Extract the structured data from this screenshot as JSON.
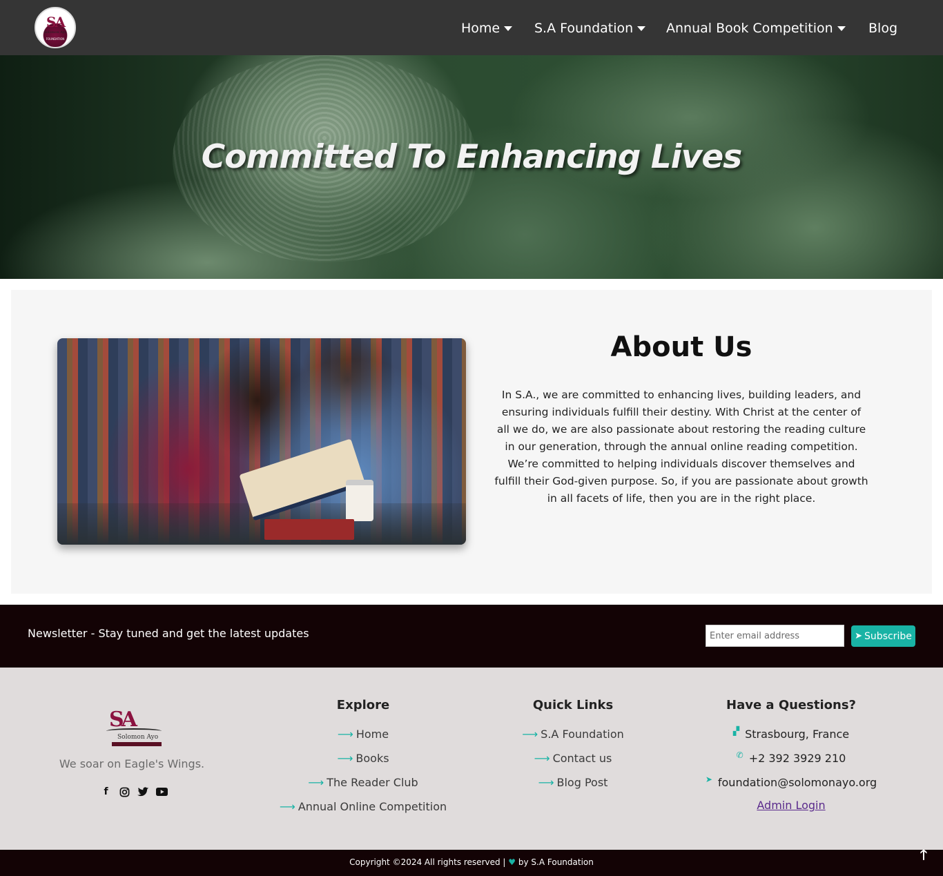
{
  "nav": {
    "items": [
      {
        "label": "Home",
        "dropdown": true
      },
      {
        "label": "S.A Foundation",
        "dropdown": true
      },
      {
        "label": "Annual Book Competition",
        "dropdown": true
      },
      {
        "label": "Blog",
        "dropdown": false
      }
    ],
    "logo_icon": "sa-foundation-logo"
  },
  "hero": {
    "title": "Committed To Enhancing Lives"
  },
  "about": {
    "title": "About Us",
    "text": "In S.A., we are committed to enhancing lives, building leaders, and ensuring individuals fulfill their destiny. With Christ at the center of all we do, we are also passionate about restoring the reading culture in our generation, through the annual online reading competition. We’re committed to helping individuals discover themselves and fulfill their God-given purpose. So, if you are passionate about growth in all facets of life, then you are in the right place."
  },
  "newsletter": {
    "text": "Newsletter - Stay tuned and get the latest updates",
    "placeholder": "Enter email address",
    "button": "Subscribe"
  },
  "footer": {
    "tagline": "We soar on Eagle's Wings.",
    "social": [
      "facebook-icon",
      "instagram-icon",
      "twitter-icon",
      "youtube-icon"
    ],
    "explore": {
      "title": "Explore",
      "links": [
        "Home",
        "Books",
        "The Reader Club",
        "Annual Online Competition"
      ]
    },
    "quick_links": {
      "title": "Quick Links",
      "links": [
        "S.A Foundation",
        "Contact us",
        "Blog Post"
      ]
    },
    "questions": {
      "title": "Have a Questions?",
      "address": "Strasbourg, France",
      "phone": "+2 392 3929 210",
      "email": "foundation@solomonayo.org",
      "admin": "Admin Login"
    }
  },
  "copyright": {
    "prefix": "Copyright ©2024 All rights reserved |",
    "suffix": "by S.A Foundation"
  },
  "colors": {
    "nav_bg": "#353535",
    "accent": "#19b3a5",
    "dark_band": "#130305",
    "footer_bg": "#e0dcdc",
    "about_bg": "#f6f6f6"
  }
}
